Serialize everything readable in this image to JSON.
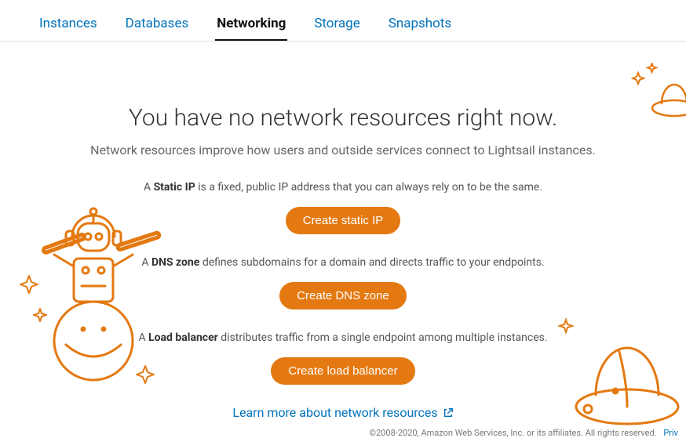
{
  "tabs": {
    "instances": "Instances",
    "databases": "Databases",
    "networking": "Networking",
    "storage": "Storage",
    "snapshots": "Snapshots"
  },
  "main": {
    "heading": "You have no network resources right now.",
    "subheading": "Network resources improve how users and outside services connect to Lightsail instances.",
    "sections": {
      "staticip": {
        "prefix": "A ",
        "bold": "Static IP",
        "rest": " is a fixed, public IP address that you can always rely on to be the same.",
        "button": "Create static IP"
      },
      "dnszone": {
        "prefix": "A ",
        "bold": "DNS zone",
        "rest": " defines subdomains for a domain and directs traffic to your endpoints.",
        "button": "Create DNS zone"
      },
      "loadbalancer": {
        "prefix": "A ",
        "bold": "Load balancer",
        "rest": " distributes traffic from a single endpoint among multiple instances.",
        "button": "Create load balancer"
      }
    },
    "learn_more": "Learn more about network resources"
  },
  "footer": {
    "copyright": "©2008-2020, Amazon Web Services, Inc. or its affiliates. All rights reserved.",
    "privacy": "Priv"
  }
}
